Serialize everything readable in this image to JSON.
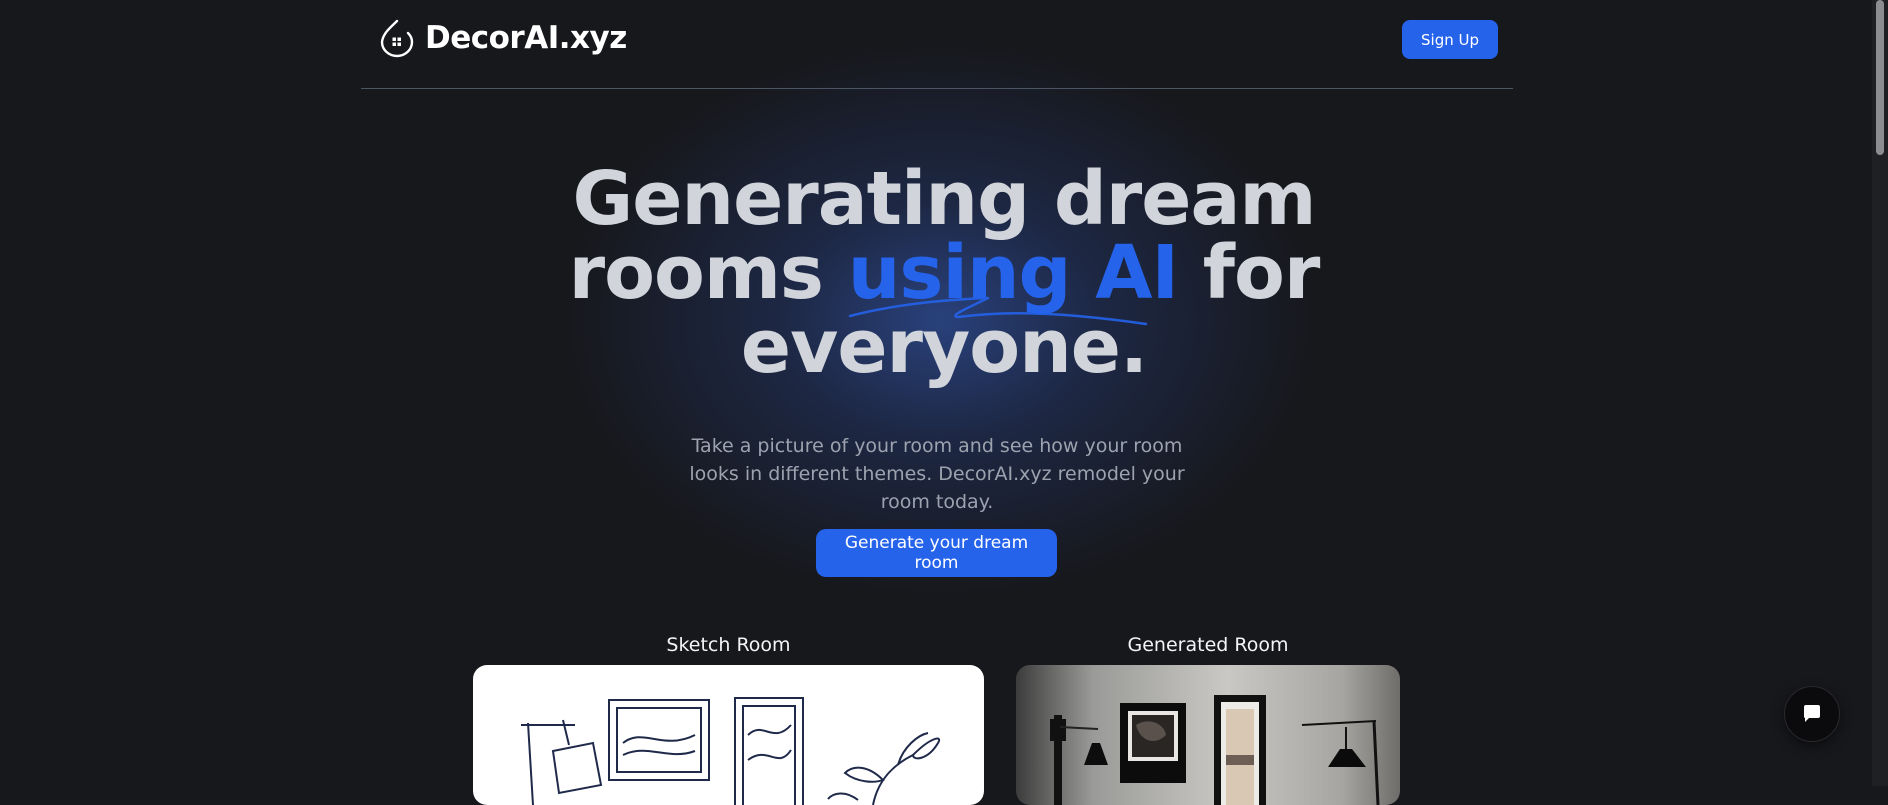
{
  "header": {
    "brand": "DecorAI.xyz",
    "signup_label": "Sign Up"
  },
  "hero": {
    "title_line1": "Generating dream",
    "title_line2_pre": "rooms ",
    "title_line2_highlight": "using AI",
    "title_line2_post": " for",
    "title_line3": "everyone.",
    "subtitle": "Take a picture of your room and see how your room looks in different themes. DecorAI.xyz remodel your room today.",
    "cta_label": "Generate your dream room"
  },
  "showcase": {
    "sketch_label": "Sketch Room",
    "generated_label": "Generated Room"
  },
  "icons": {
    "logo": "house-drop-icon",
    "chat": "chat-bubble-icon"
  },
  "colors": {
    "background": "#17181c",
    "accent": "#2563eb",
    "title_text": "#d1d5db",
    "muted_text": "#9ca3af"
  }
}
